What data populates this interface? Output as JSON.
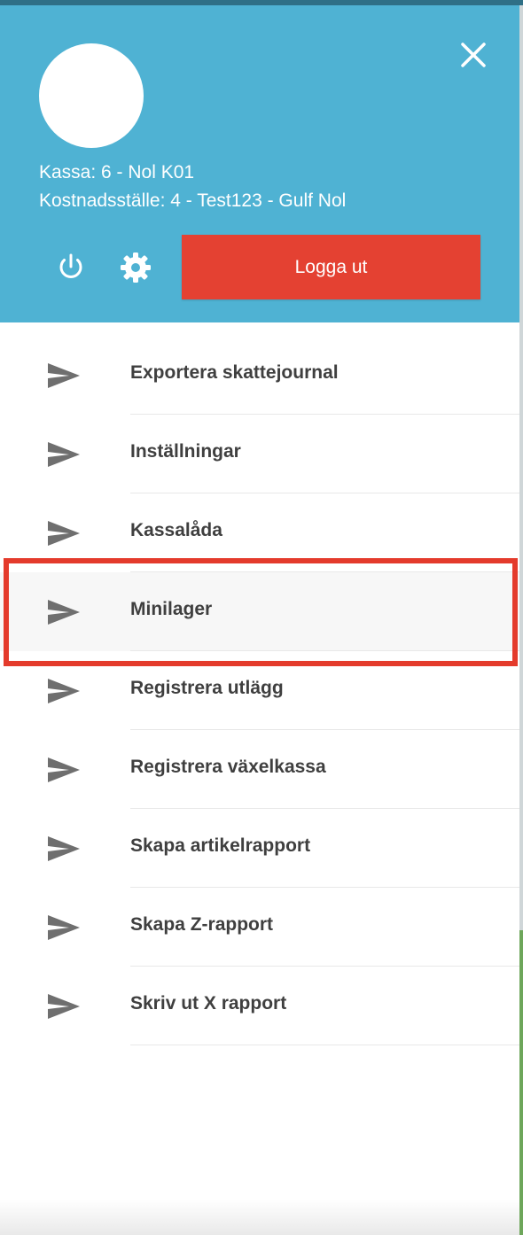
{
  "colors": {
    "header": "#4fb2d3",
    "logout": "#e44132",
    "highlight": "#e43b2c",
    "icon": "#6f6f6f",
    "text": "#3f3f3f"
  },
  "header": {
    "close_icon": "close-icon",
    "kassa": "Kassa: 6 - Nol K01",
    "kostnadsstalle": "Kostnadsställe: 4 - Test123 - Gulf Nol",
    "power_icon": "power-icon",
    "settings_icon": "gear-icon",
    "logout_label": "Logga ut"
  },
  "menu": {
    "icon": "send-icon",
    "items": [
      {
        "label": "Exportera skattejournal"
      },
      {
        "label": "Inställningar"
      },
      {
        "label": "Kassalåda"
      },
      {
        "label": "Minilager"
      },
      {
        "label": "Registrera utlägg"
      },
      {
        "label": "Registrera växelkassa"
      },
      {
        "label": "Skapa artikelrapport"
      },
      {
        "label": "Skapa Z-rapport"
      },
      {
        "label": "Skriv ut X rapport"
      }
    ],
    "highlighted_item": "Minilager"
  }
}
